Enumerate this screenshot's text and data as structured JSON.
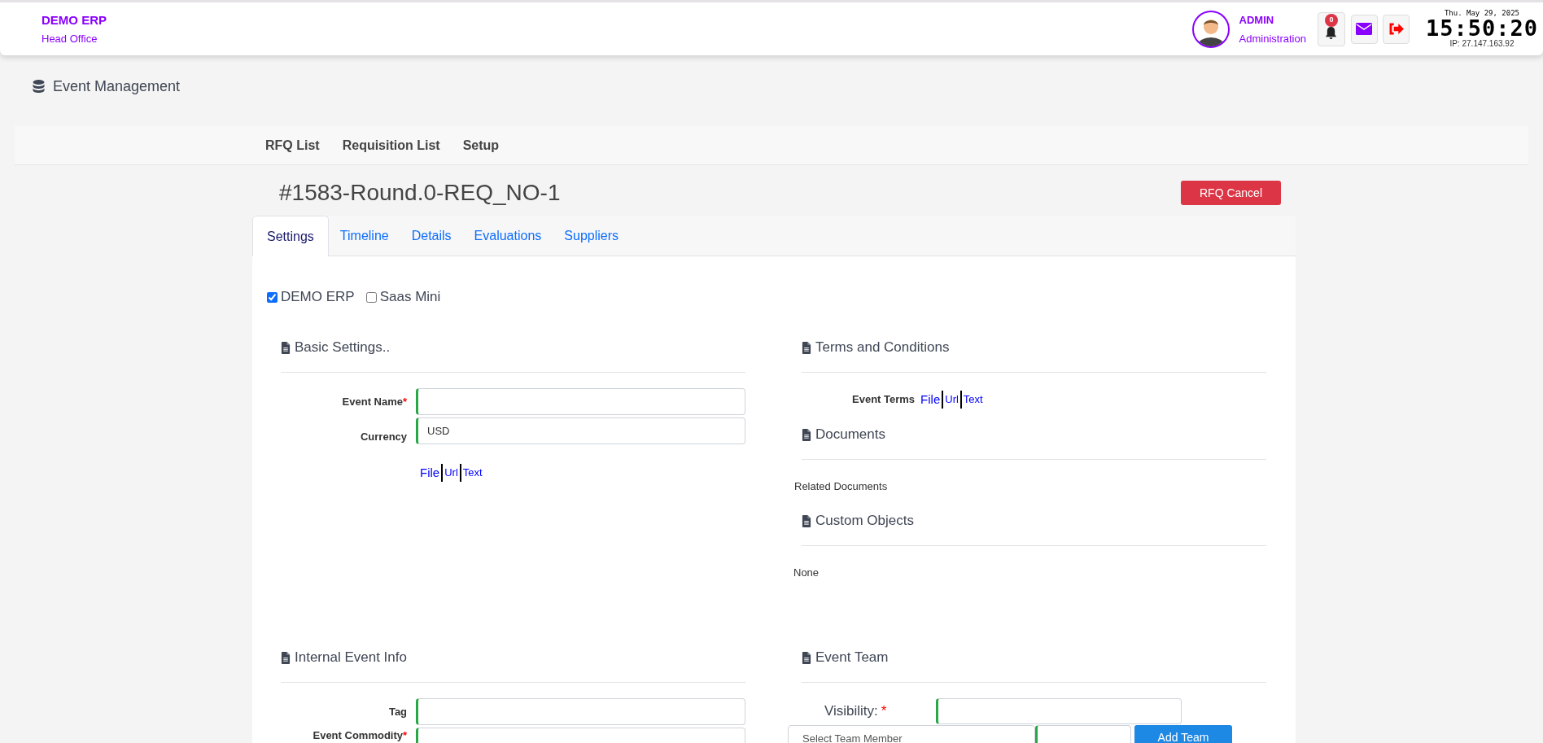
{
  "header": {
    "company": "DEMO ERP",
    "branch": "Head Office",
    "user": {
      "name": "ADMIN",
      "role": "Administration"
    },
    "notification_count": "0",
    "clock": {
      "date": "Thu. May 29, 2025",
      "time": "15:50:20",
      "ip": "IP: 27.147.163.92"
    }
  },
  "breadcrumb": "Event Management",
  "nav": [
    "RFQ List",
    "Requisition List",
    "Setup"
  ],
  "event_title": "#1583-Round.0-REQ_NO-1",
  "cancel_button": "RFQ Cancel",
  "tabs": [
    {
      "label": "Settings",
      "selected": true
    },
    {
      "label": "Timeline",
      "selected": false
    },
    {
      "label": "Details",
      "selected": false
    },
    {
      "label": "Evaluations",
      "selected": false
    },
    {
      "label": "Suppliers",
      "selected": false
    }
  ],
  "companies": [
    {
      "label": "DEMO ERP",
      "checked": true
    },
    {
      "label": "Saas Mini",
      "checked": false
    }
  ],
  "basic_settings": {
    "title": "Basic Settings..",
    "fields": [
      {
        "label": "Event Name",
        "required_mark": "*"
      },
      {
        "label": "Currency",
        "value": "USD"
      }
    ],
    "links": [
      "File",
      "Url",
      "Text"
    ]
  },
  "terms": {
    "title": "Terms and Conditions",
    "label": "Event Terms",
    "links": [
      "File",
      "Url",
      "Text"
    ]
  },
  "documents": {
    "title": "Documents",
    "text": "Related Documents"
  },
  "custom_objects": {
    "title": "Custom Objects",
    "text": "None"
  },
  "internal_info": {
    "title": "Internal Event Info",
    "fields": [
      {
        "label": "Tag"
      },
      {
        "label": "Event Commodity",
        "required_mark": "*"
      }
    ]
  },
  "event_team": {
    "title": "Event Team",
    "visibility_label": "Visibility:",
    "required_mark": "*",
    "member_placeholder": "Select Team Member",
    "add_button": "Add Team"
  }
}
